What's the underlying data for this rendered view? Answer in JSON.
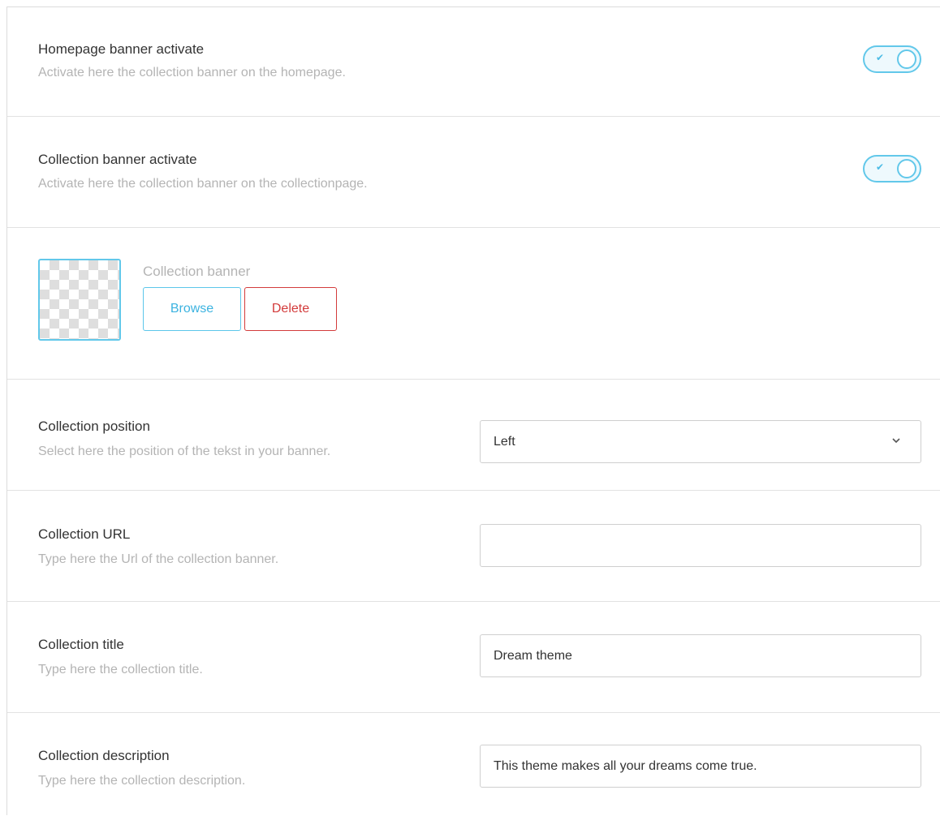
{
  "settings": {
    "homepage_banner": {
      "label": "Homepage banner activate",
      "description": "Activate here the collection banner on the homepage.",
      "enabled": true,
      "toggle_icon": "check-icon"
    },
    "collection_banner": {
      "label": "Collection banner activate",
      "description": "Activate here the collection banner on the collectionpage.",
      "enabled": true,
      "toggle_icon": "check-icon"
    },
    "banner_image": {
      "label": "Collection banner",
      "browse_label": "Browse",
      "delete_label": "Delete"
    },
    "position": {
      "label": "Collection position",
      "description": "Select here the position of the tekst in your banner.",
      "selected": "Left"
    },
    "url": {
      "label": "Collection URL",
      "description": "Type here the Url of the collection banner.",
      "value": ""
    },
    "title": {
      "label": "Collection title",
      "description": "Type here the collection title.",
      "value": "Dream theme"
    },
    "description": {
      "label": "Collection description",
      "description": "Type here the collection description.",
      "value": "This theme makes all your dreams come true."
    }
  },
  "colors": {
    "accent": "#5cc6ea",
    "danger": "#d33b3b",
    "muted_text": "#b4b4b4",
    "border": "#cfcfcf"
  }
}
